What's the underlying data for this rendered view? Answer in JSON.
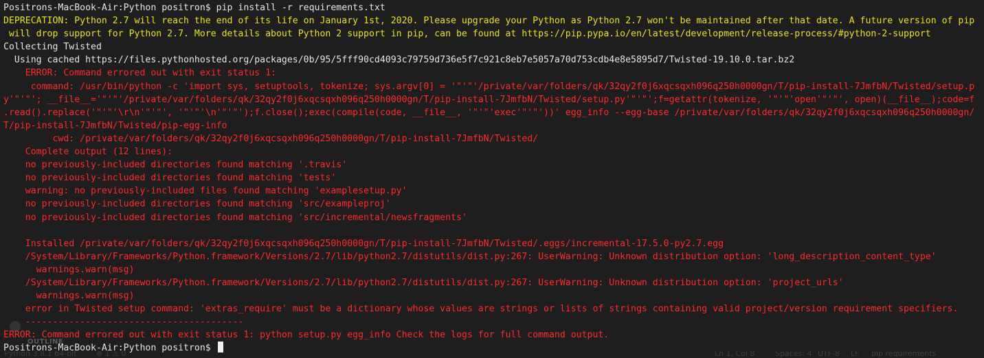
{
  "terminal": {
    "lines": [
      {
        "text": "Positrons-MacBook-Air:Python positron$ pip install -r requirements.txt",
        "color": "white"
      },
      {
        "text": "DEPRECATION: Python 2.7 will reach the end of its life on January 1st, 2020. Please upgrade your Python as Python 2.7 won't be maintained after that date. A future version of pip",
        "color": "yellow"
      },
      {
        "text": " will drop support for Python 2.7. More details about Python 2 support in pip, can be found at https://pip.pypa.io/en/latest/development/release-process/#python-2-support",
        "color": "yellow"
      },
      {
        "text": "Collecting Twisted",
        "color": "white"
      },
      {
        "text": "  Using cached https://files.pythonhosted.org/packages/0b/95/5fff90cd4093c79759d736e5f7c921c8eb7e5057a70d753cdb4e8e5895d7/Twisted-19.10.0.tar.bz2",
        "color": "white"
      },
      {
        "text": "    ERROR: Command errored out with exit status 1:",
        "color": "red"
      },
      {
        "text": "     command: /usr/bin/python -c 'import sys, setuptools, tokenize; sys.argv[0] = '\"'\"'/private/var/folders/qk/32qy2f0j6xqcsqxh096q250h0000gn/T/pip-install-7JmfbN/Twisted/setup.p",
        "color": "red"
      },
      {
        "text": "y'\"'\"'; __file__='\"'\"'/private/var/folders/qk/32qy2f0j6xqcsqxh096q250h0000gn/T/pip-install-7JmfbN/Twisted/setup.py'\"'\"';f=getattr(tokenize, '\"'\"'open'\"'\"', open)(__file__);code=f",
        "color": "red"
      },
      {
        "text": ".read().replace('\"'\"'\\r\\n'\"'\"', '\"'\"'\\n'\"'\"');f.close();exec(compile(code, __file__, '\"'\"'exec'\"'\"'))' egg_info --egg-base /private/var/folders/qk/32qy2f0j6xqcsqxh096q250h0000gn/",
        "color": "red"
      },
      {
        "text": "T/pip-install-7JmfbN/Twisted/pip-egg-info",
        "color": "red"
      },
      {
        "text": "         cwd: /private/var/folders/qk/32qy2f0j6xqcsqxh096q250h0000gn/T/pip-install-7JmfbN/Twisted/",
        "color": "red"
      },
      {
        "text": "    Complete output (12 lines):",
        "color": "red"
      },
      {
        "text": "    no previously-included directories found matching '.travis'",
        "color": "red"
      },
      {
        "text": "    no previously-included directories found matching 'tests'",
        "color": "red"
      },
      {
        "text": "    warning: no previously-included files found matching 'examplesetup.py'",
        "color": "red"
      },
      {
        "text": "    no previously-included directories found matching 'src/exampleproj'",
        "color": "red"
      },
      {
        "text": "    no previously-included directories found matching 'src/incremental/newsfragments'",
        "color": "red"
      },
      {
        "text": "",
        "color": "red"
      },
      {
        "text": "    Installed /private/var/folders/qk/32qy2f0j6xqcsqxh096q250h0000gn/T/pip-install-7JmfbN/Twisted/.eggs/incremental-17.5.0-py2.7.egg",
        "color": "red"
      },
      {
        "text": "    /System/Library/Frameworks/Python.framework/Versions/2.7/lib/python2.7/distutils/dist.py:267: UserWarning: Unknown distribution option: 'long_description_content_type'",
        "color": "red"
      },
      {
        "text": "      warnings.warn(msg)",
        "color": "red"
      },
      {
        "text": "    /System/Library/Frameworks/Python.framework/Versions/2.7/lib/python2.7/distutils/dist.py:267: UserWarning: Unknown distribution option: 'project_urls'",
        "color": "red"
      },
      {
        "text": "      warnings.warn(msg)",
        "color": "red"
      },
      {
        "text": "    error in Twisted setup command: 'extras_require' must be a dictionary whose values are strings or lists of strings containing valid project/version requirement specifiers.",
        "color": "red"
      },
      {
        "text": "    ----------------------------------------",
        "color": "red"
      },
      {
        "text": "ERROR: Command errored out with exit status 1: python setup.py egg_info Check the logs for full command output.",
        "color": "red"
      }
    ],
    "prompt": "Positrons-MacBook-Air:Python positron$ "
  },
  "background_ui": {
    "outline_label": "OUTLINE",
    "status_items": [
      "Python 3.8.1 64-bit",
      "⊗ 1 ⚠ 0",
      "Ln 1, Col 8",
      "Spaces: 4",
      "UTF-8",
      "LF",
      "pip requirements"
    ]
  },
  "colors": {
    "background": "#1e1e1e",
    "white": "#e6e6e6",
    "yellow": "#e5e510",
    "red": "#ff2a2a"
  }
}
